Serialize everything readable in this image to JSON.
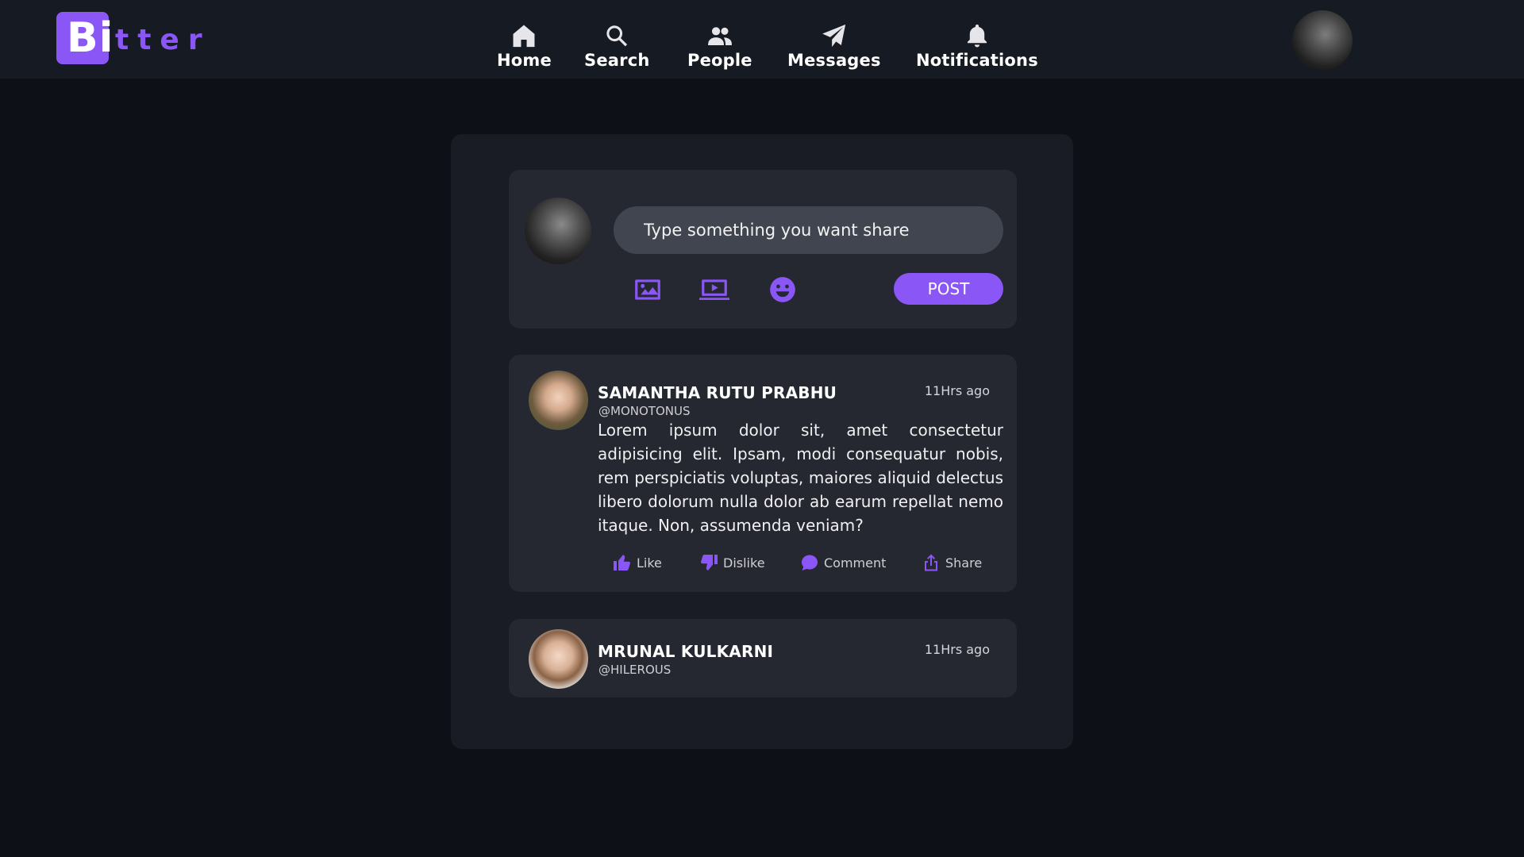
{
  "brand": {
    "first": "B",
    "second": "i",
    "rest": "tter",
    "accent": "#8b56f6"
  },
  "nav": {
    "items": [
      {
        "label": "Home",
        "icon": "home-icon"
      },
      {
        "label": "Search",
        "icon": "search-icon"
      },
      {
        "label": "People",
        "icon": "people-icon"
      },
      {
        "label": "Messages",
        "icon": "paper-plane-icon"
      },
      {
        "label": "Notifications",
        "icon": "bell-icon"
      }
    ]
  },
  "composer": {
    "placeholder": "Type something you want share",
    "tools": [
      "image-icon",
      "video-icon",
      "emoji-icon"
    ],
    "post_label": "POST"
  },
  "posts": [
    {
      "name": "SAMANTHA RUTU PRABHU",
      "handle": "@MONOTONUS",
      "time": "11Hrs ago",
      "body": "Lorem ipsum dolor sit, amet consectetur adipisicing elit. Ipsam, modi consequatur nobis, rem perspiciatis voluptas, maiores aliquid delectus libero dolorum nulla dolor ab earum repellat nemo itaque. Non, assumenda veniam?",
      "actions": {
        "like": "Like",
        "dislike": "Dislike",
        "comment": "Comment",
        "share": "Share"
      }
    },
    {
      "name": "MRUNAL KULKARNI",
      "handle": "@HILEROUS",
      "time": "11Hrs ago"
    }
  ],
  "colors": {
    "background": "#0d1017",
    "navbar": "#161a22",
    "panel": "#191c24",
    "card": "#252830",
    "accent": "#8b56f6"
  }
}
